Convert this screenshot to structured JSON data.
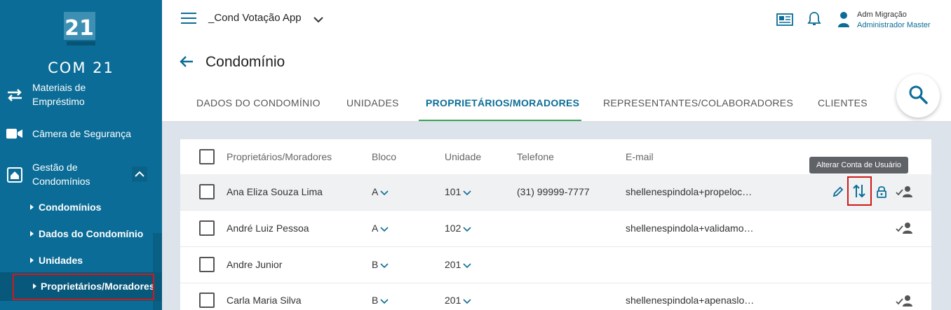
{
  "sidebar": {
    "logo_number": "21",
    "logo_text": "COM 21",
    "items": [
      {
        "label": "Materiais de Empréstimo",
        "icon": "swap-arrows-icon"
      },
      {
        "label": "Câmera de Segurança",
        "icon": "videocam-icon"
      },
      {
        "label": "Gestão de Condomínios",
        "icon": "building-icon"
      }
    ],
    "sub_items": [
      {
        "label": "Condomínios"
      },
      {
        "label": "Dados do Condomínio"
      },
      {
        "label": "Unidades"
      },
      {
        "label": "Proprietários/Moradores"
      }
    ]
  },
  "topbar": {
    "app_name": "_Cond Votação App",
    "user_name": "Adm Migração",
    "user_role": "Administrador Master"
  },
  "page": {
    "title": "Condomínio"
  },
  "tabs": [
    {
      "label": "DADOS DO CONDOMÍNIO"
    },
    {
      "label": "UNIDADES"
    },
    {
      "label": "PROPRIETÁRIOS/MORADORES"
    },
    {
      "label": "REPRESENTANTES/COLABORADORES"
    },
    {
      "label": "CLIENTES"
    }
  ],
  "table": {
    "headers": [
      "Proprietários/Moradores",
      "Bloco",
      "Unidade",
      "Telefone",
      "E-mail"
    ],
    "rows": [
      {
        "name": "Ana Eliza Souza Lima",
        "bloco": "A",
        "unidade": "101",
        "telefone": "(31) 99999-7777",
        "email": "shellenespindola+propeloc…"
      },
      {
        "name": "André Luiz Pessoa",
        "bloco": "A",
        "unidade": "102",
        "telefone": "",
        "email": "shellenespindola+validamo…"
      },
      {
        "name": "Andre Junior",
        "bloco": "B",
        "unidade": "201",
        "telefone": "",
        "email": ""
      },
      {
        "name": "Carla Maria Silva",
        "bloco": "B",
        "unidade": "201",
        "telefone": "",
        "email": "shellenespindola+apenaslo…"
      }
    ]
  },
  "tooltip": "Alterar Conta de Usuário",
  "colors": {
    "primary": "#0b6d97",
    "accent_green": "#3aa355",
    "highlight_red": "#d11919"
  }
}
